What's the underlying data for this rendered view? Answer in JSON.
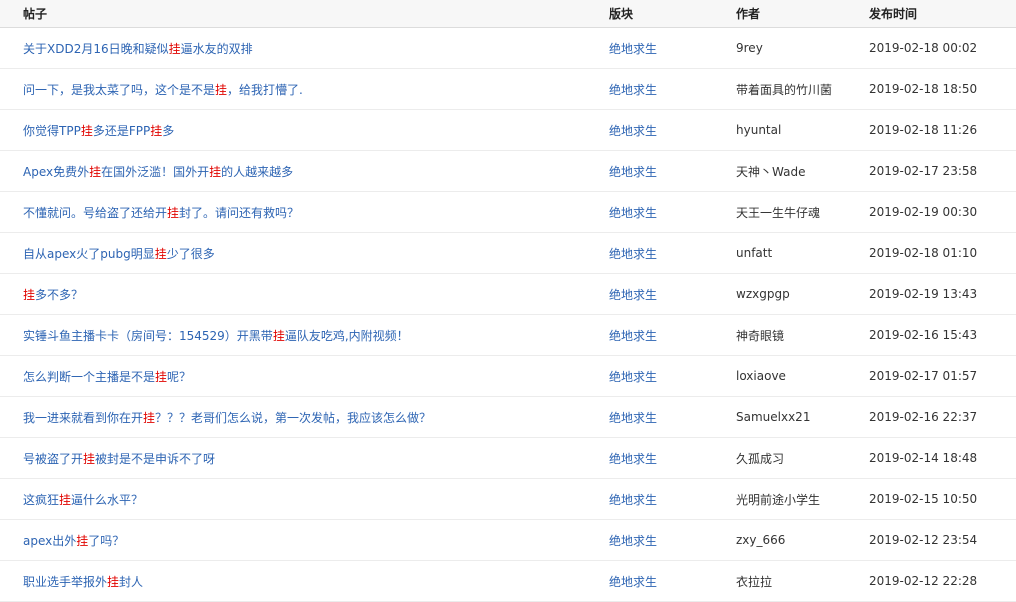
{
  "colors": {
    "link": "#2d64b3",
    "keyword_highlight": "#e10602"
  },
  "headers": {
    "title": "帖子",
    "board": "版块",
    "author": "作者",
    "time": "发布时间"
  },
  "rows": [
    {
      "title": [
        {
          "t": "关于XDD2月16日晚和疑似"
        },
        {
          "t": "挂",
          "hl": true
        },
        {
          "t": "逼水友的双排"
        }
      ],
      "board": "绝地求生",
      "author": "9rey",
      "time": "2019-02-18 00:02"
    },
    {
      "title": [
        {
          "t": "问一下，是我太菜了吗，这个是不是"
        },
        {
          "t": "挂",
          "hl": true
        },
        {
          "t": "，给我打懵了."
        }
      ],
      "board": "绝地求生",
      "author": "带着面具的竹川菌",
      "time": "2019-02-18 18:50"
    },
    {
      "title": [
        {
          "t": "你觉得TPP"
        },
        {
          "t": "挂",
          "hl": true
        },
        {
          "t": "多还是FPP"
        },
        {
          "t": "挂",
          "hl": true
        },
        {
          "t": "多"
        }
      ],
      "board": "绝地求生",
      "author": "hyuntal",
      "time": "2019-02-18 11:26"
    },
    {
      "title": [
        {
          "t": "Apex免费外"
        },
        {
          "t": "挂",
          "hl": true
        },
        {
          "t": "在国外泛滥！国外开"
        },
        {
          "t": "挂",
          "hl": true
        },
        {
          "t": "的人越来越多"
        }
      ],
      "board": "绝地求生",
      "author": "天神丶Wade",
      "time": "2019-02-17 23:58"
    },
    {
      "title": [
        {
          "t": "不懂就问。号给盗了还给开"
        },
        {
          "t": "挂",
          "hl": true
        },
        {
          "t": "封了。请问还有救吗？"
        }
      ],
      "board": "绝地求生",
      "author": "天王一生牛仔魂",
      "time": "2019-02-19 00:30"
    },
    {
      "title": [
        {
          "t": "自从apex火了pubg明显"
        },
        {
          "t": "挂",
          "hl": true
        },
        {
          "t": "少了很多"
        }
      ],
      "board": "绝地求生",
      "author": "unfatt",
      "time": "2019-02-18 01:10"
    },
    {
      "title": [
        {
          "t": "挂",
          "hl": true
        },
        {
          "t": "多不多？"
        }
      ],
      "board": "绝地求生",
      "author": "wzxgpgp",
      "time": "2019-02-19 13:43"
    },
    {
      "title": [
        {
          "t": "实锤斗鱼主播卡卡（房间号：154529）开黑带"
        },
        {
          "t": "挂",
          "hl": true
        },
        {
          "t": "逼队友吃鸡,内附视频！"
        }
      ],
      "board": "绝地求生",
      "author": "神奇眼镜",
      "time": "2019-02-16 15:43"
    },
    {
      "title": [
        {
          "t": "怎么判断一个主播是不是"
        },
        {
          "t": "挂",
          "hl": true
        },
        {
          "t": "呢？"
        }
      ],
      "board": "绝地求生",
      "author": "loxiaove",
      "time": "2019-02-17 01:57"
    },
    {
      "title": [
        {
          "t": "我一进来就看到你在开"
        },
        {
          "t": "挂",
          "hl": true
        },
        {
          "t": "？？？老哥们怎么说，第一次发帖，我应该怎么做？"
        }
      ],
      "board": "绝地求生",
      "author": "Samuelxx21",
      "time": "2019-02-16 22:37"
    },
    {
      "title": [
        {
          "t": "号被盗了开"
        },
        {
          "t": "挂",
          "hl": true
        },
        {
          "t": "被封是不是申诉不了呀"
        }
      ],
      "board": "绝地求生",
      "author": "久孤成习",
      "time": "2019-02-14 18:48"
    },
    {
      "title": [
        {
          "t": "这疯狂"
        },
        {
          "t": "挂",
          "hl": true
        },
        {
          "t": "逼什么水平？"
        }
      ],
      "board": "绝地求生",
      "author": "光明前途小学生",
      "time": "2019-02-15 10:50"
    },
    {
      "title": [
        {
          "t": "apex出外"
        },
        {
          "t": "挂",
          "hl": true
        },
        {
          "t": "了吗？"
        }
      ],
      "board": "绝地求生",
      "author": "zxy_666",
      "time": "2019-02-12 23:54"
    },
    {
      "title": [
        {
          "t": "职业选手举报外"
        },
        {
          "t": "挂",
          "hl": true
        },
        {
          "t": "封人"
        }
      ],
      "board": "绝地求生",
      "author": "衣拉拉",
      "time": "2019-02-12 22:28"
    }
  ]
}
